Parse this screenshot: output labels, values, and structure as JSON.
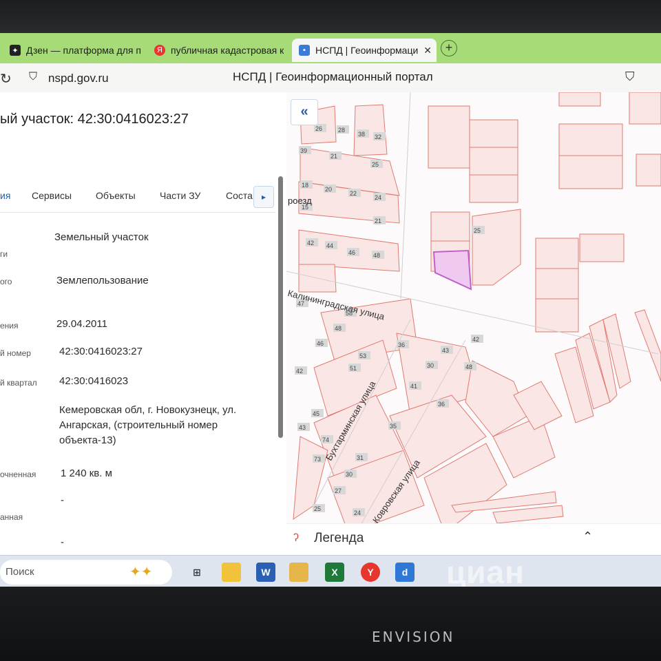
{
  "browser": {
    "tabs": [
      {
        "label": "Дзен — платформа для п",
        "icon": "dzen-icon",
        "color": "#1d1d1d"
      },
      {
        "label": "публичная кадастровая к",
        "icon": "yandex-icon",
        "color": "#e7362d"
      },
      {
        "label": "НСПД | Геоинформаци",
        "icon": "nspd-icon",
        "color": "#3b7bd8"
      }
    ],
    "url": "nspd.gov.ru",
    "page_title": "НСПД | Геоинформационный портал"
  },
  "panel": {
    "title": "ый участок: 42:30:0416023:27",
    "tabs": [
      "ия",
      "Сервисы",
      "Объекты",
      "Части ЗУ",
      "Соста"
    ],
    "rows": [
      {
        "label": "ги",
        "value": "Земельный участок"
      },
      {
        "label": "ого",
        "value": "Землепользование"
      },
      {
        "label": "ения",
        "value": "29.04.2011"
      },
      {
        "label": "й номер",
        "value": "42:30:0416023:27"
      },
      {
        "label": "й квартал",
        "value": "42:30:0416023"
      },
      {
        "label": "",
        "value": "Кемеровская обл, г. Новокузнецк, ул. Ангарская, (строительный номер объекта-13)"
      },
      {
        "label": "очненная",
        "value": "1 240 кв. м"
      },
      {
        "label": "",
        "value": "-"
      },
      {
        "label": "анная",
        "value": "-"
      }
    ]
  },
  "map": {
    "streets": [
      "роезд",
      "Калининградская улица",
      "Бухтарминская улица",
      "Ковровская улица"
    ],
    "lot_numbers": [
      "26",
      "28",
      "38",
      "32",
      "39",
      "21",
      "25",
      "18",
      "20",
      "22",
      "24",
      "15",
      "21",
      "42",
      "44",
      "46",
      "48",
      "25",
      "47",
      "58",
      "48",
      "46",
      "53",
      "36",
      "43",
      "42",
      "51",
      "30",
      "48",
      "41",
      "42",
      "45",
      "36",
      "35",
      "43",
      "74",
      "31",
      "73",
      "30",
      "27",
      "25",
      "24"
    ],
    "highlight_color": "#c060c8"
  },
  "legend": {
    "label": "Легенда"
  },
  "taskbar": {
    "search_placeholder": "Поиск"
  },
  "watermark": {
    "text": "циан",
    "id": "ID 323138150"
  },
  "monitor": {
    "brand": "ENVISION"
  }
}
